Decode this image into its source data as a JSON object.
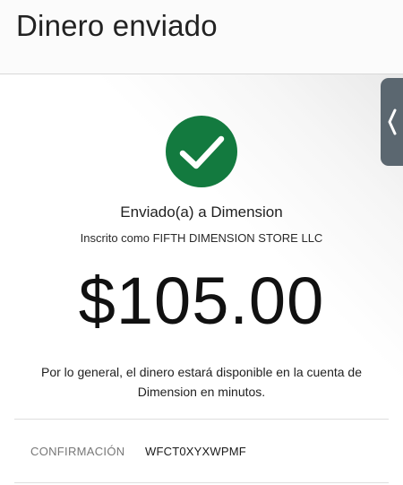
{
  "header": {
    "title": "Dinero enviado"
  },
  "confirmation_screen": {
    "status_icon": "check-icon",
    "sent_to": "Enviado(a) a Dimension",
    "enrolled_as": "Inscrito como FIFTH DIMENSION STORE LLC",
    "amount": "$105.00",
    "info_message": "Por lo general, el dinero estará disponible en la cuenta de Dimension en minutos.",
    "confirmation_label": "CONFIRMACIÓN",
    "confirmation_number": "WFCT0XYXWPMF"
  },
  "side_panel_tab": {
    "icon": "chevron-left-icon"
  },
  "colors": {
    "success_green": "#137a3f",
    "side_tab": "#5b6770"
  }
}
